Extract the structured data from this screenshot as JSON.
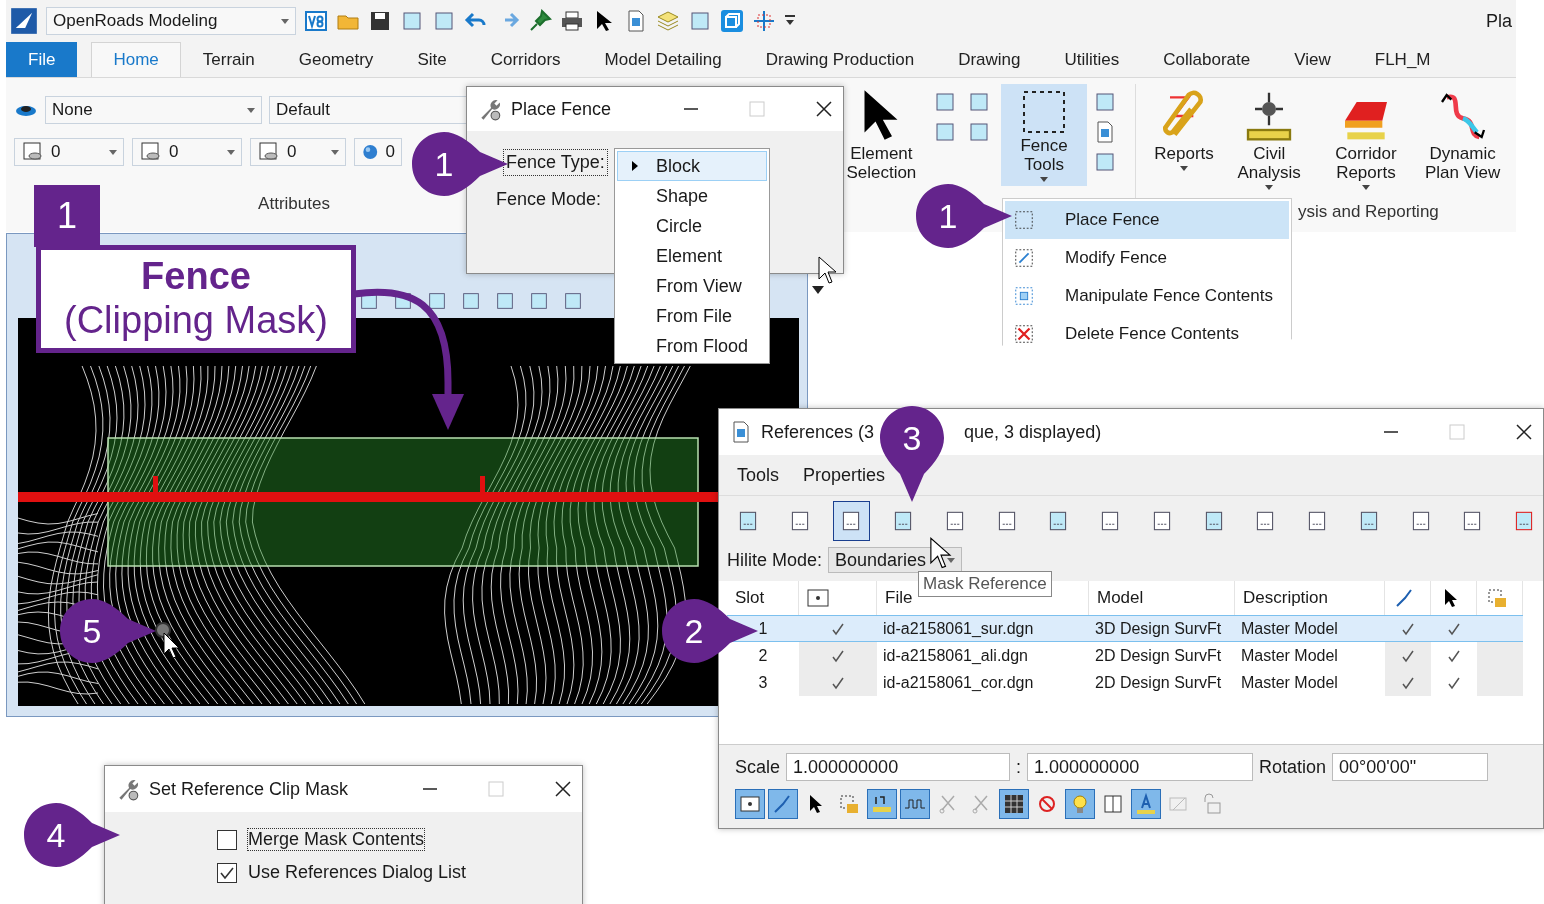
{
  "app": {
    "workflow": "OpenRoads Modeling",
    "title_fragment": "Pla"
  },
  "ribbon_tabs": [
    {
      "label": "File",
      "kind": "file",
      "selected": false
    },
    {
      "label": "Home",
      "kind": "tab",
      "selected": true
    },
    {
      "label": "Terrain",
      "kind": "tab",
      "selected": false
    },
    {
      "label": "Geometry",
      "kind": "tab",
      "selected": false
    },
    {
      "label": "Site",
      "kind": "tab",
      "selected": false
    },
    {
      "label": "Corridors",
      "kind": "tab",
      "selected": false
    },
    {
      "label": "Model Detailing",
      "kind": "tab",
      "selected": false
    },
    {
      "label": "Drawing Production",
      "kind": "tab",
      "selected": false
    },
    {
      "label": "Drawing",
      "kind": "tab",
      "selected": false
    },
    {
      "label": "Utilities",
      "kind": "tab",
      "selected": false
    },
    {
      "label": "Collaborate",
      "kind": "tab",
      "selected": false
    },
    {
      "label": "View",
      "kind": "tab",
      "selected": false
    },
    {
      "label": "FLH_M",
      "kind": "tab",
      "selected": false
    }
  ],
  "attributes": {
    "level": "None",
    "style": "Default",
    "values": [
      "0",
      "0",
      "0",
      "0"
    ],
    "group_label": "Attributes"
  },
  "ribbon_buttons": [
    {
      "label": "Element Selection",
      "kind": "select",
      "has_menu": false,
      "selected": false
    },
    {
      "label": "Fence Tools",
      "kind": "fence",
      "has_menu": true,
      "selected": true
    },
    {
      "label": "Reports",
      "kind": "reports",
      "has_menu": true,
      "selected": false
    },
    {
      "label": "Civil Analysis",
      "kind": "civil",
      "has_menu": true,
      "selected": false
    },
    {
      "label": "Corridor Reports",
      "kind": "corridor",
      "has_menu": true,
      "selected": false
    },
    {
      "label": "Dynamic Plan View",
      "kind": "dynamic",
      "has_menu": false,
      "selected": false
    }
  ],
  "group_label_right": "ysis and Reporting",
  "place_fence": {
    "title": "Place Fence",
    "fence_type_label": "Fence Type:",
    "fence_mode_label": "Fence Mode:"
  },
  "fence_type_options": [
    {
      "label": "Block",
      "selected": true
    },
    {
      "label": "Shape",
      "selected": false
    },
    {
      "label": "Circle",
      "selected": false
    },
    {
      "label": "Element",
      "selected": false
    },
    {
      "label": "From View",
      "selected": false
    },
    {
      "label": "From File",
      "selected": false
    },
    {
      "label": "From Flood",
      "selected": false
    }
  ],
  "fence_tools_menu": [
    {
      "label": "Place Fence",
      "kind": "place",
      "selected": true
    },
    {
      "label": "Modify Fence",
      "kind": "modify",
      "selected": false
    },
    {
      "label": "Manipulate Fence Contents",
      "kind": "manipulate",
      "selected": false
    },
    {
      "label": "Delete Fence Contents",
      "kind": "delete",
      "selected": false
    }
  ],
  "fence_label": {
    "title": "Fence",
    "subtitle": "(Clipping Mask)"
  },
  "references": {
    "title_start": "References (3",
    "title_end": "que, 3 displayed)",
    "menus": [
      "Tools",
      "Properties"
    ],
    "hilite_label": "Hilite Mode:",
    "hilite_value": "Boundaries",
    "tooltip": "Mask Reference",
    "columns": [
      "Slot",
      "File",
      "Model",
      "Description"
    ],
    "rows": [
      {
        "slot": "1",
        "file": "id-a2158061_sur.dgn",
        "model": "3D Design SurvFt",
        "description": "Master Model",
        "display": true,
        "snap": true,
        "locate": true,
        "selected": true
      },
      {
        "slot": "2",
        "file": "id-a2158061_ali.dgn",
        "model": "2D Design SurvFt",
        "description": "Master Model",
        "display": true,
        "snap": true,
        "locate": true,
        "selected": false
      },
      {
        "slot": "3",
        "file": "id-a2158061_cor.dgn",
        "model": "2D Design SurvFt",
        "description": "Master Model",
        "display": true,
        "snap": true,
        "locate": true,
        "selected": false
      }
    ],
    "scale_label": "Scale",
    "scale_1": "1.000000000",
    "scale_sep": ":",
    "scale_2": "1.000000000",
    "rotation_label": "Rotation",
    "rotation": "00°00'00\"",
    "toggles": [
      {
        "kind": "display",
        "on": true
      },
      {
        "kind": "snap",
        "on": true
      },
      {
        "kind": "locate",
        "on": false
      },
      {
        "kind": "lock",
        "on": false
      },
      {
        "kind": "scale",
        "on": true
      },
      {
        "kind": "wave",
        "on": true
      },
      {
        "kind": "clip",
        "on": false
      },
      {
        "kind": "clip",
        "on": false
      },
      {
        "kind": "grid",
        "on": true
      },
      {
        "kind": "nodisplay",
        "on": false
      },
      {
        "kind": "bulb",
        "on": true
      },
      {
        "kind": "book",
        "on": false
      },
      {
        "kind": "text",
        "on": true
      },
      {
        "kind": "dim",
        "on": false
      },
      {
        "kind": "unlock",
        "on": false
      }
    ]
  },
  "clip_mask": {
    "title": "Set Reference Clip Mask",
    "options": [
      {
        "label": "Merge Mask Contents",
        "checked": false
      },
      {
        "label": "Use References Dialog List",
        "checked": true
      }
    ]
  },
  "callouts": [
    {
      "number": "1"
    },
    {
      "number": "1"
    },
    {
      "number": "1"
    },
    {
      "number": "2"
    },
    {
      "number": "3"
    },
    {
      "number": "4"
    },
    {
      "number": "5"
    }
  ]
}
